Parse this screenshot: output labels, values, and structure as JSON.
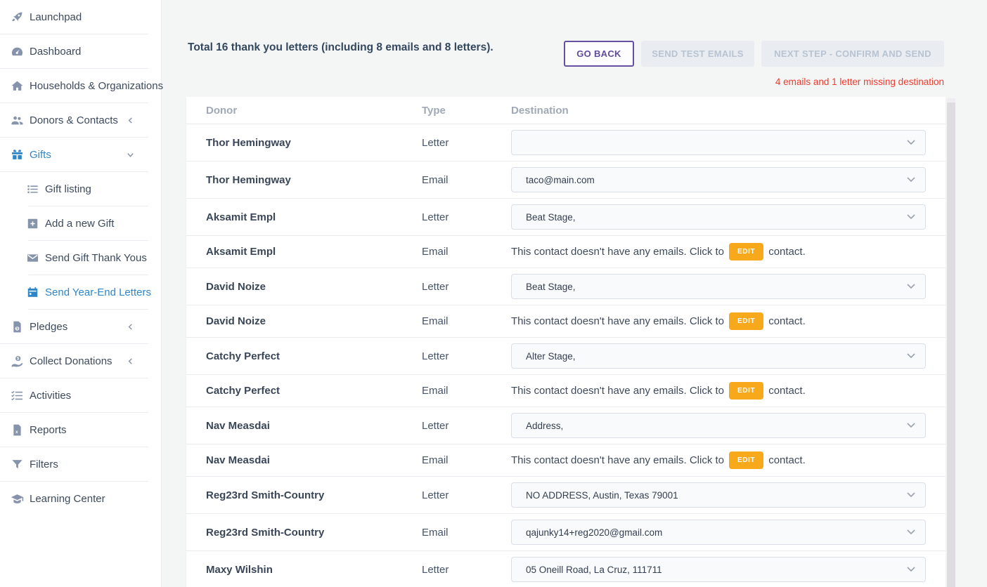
{
  "sidebar": {
    "items": [
      {
        "label": "Launchpad",
        "icon": "rocket-icon"
      },
      {
        "label": "Dashboard",
        "icon": "gauge-icon"
      },
      {
        "label": "Households & Organizations",
        "icon": "home-icon"
      },
      {
        "label": "Donors & Contacts",
        "icon": "users-icon",
        "chevron": "collapsed"
      },
      {
        "label": "Gifts",
        "icon": "gift-icon",
        "chevron": "expanded",
        "active": true
      },
      {
        "label": "Gift listing",
        "icon": "list-icon",
        "sub": true
      },
      {
        "label": "Add a new Gift",
        "icon": "plus-square-icon",
        "sub": true
      },
      {
        "label": "Send Gift Thank Yous",
        "icon": "envelope-icon",
        "sub": true
      },
      {
        "label": "Send Year-End Letters",
        "icon": "calendar-icon",
        "sub": true,
        "active": true
      },
      {
        "label": "Pledges",
        "icon": "invoice-dollar-icon",
        "chevron": "collapsed"
      },
      {
        "label": "Collect Donations",
        "icon": "hand-dollar-icon",
        "chevron": "collapsed"
      },
      {
        "label": "Activities",
        "icon": "checklist-icon"
      },
      {
        "label": "Reports",
        "icon": "file-report-icon"
      },
      {
        "label": "Filters",
        "icon": "funnel-icon"
      },
      {
        "label": "Learning Center",
        "icon": "graduation-cap-icon"
      }
    ]
  },
  "header": {
    "total_text": "Total 16 thank you letters (including 8 emails and 8 letters).",
    "buttons": {
      "go_back": "GO BACK",
      "send_test": "SEND TEST EMAILS",
      "next_step": "NEXT STEP - CONFIRM AND SEND"
    },
    "warning": "4 emails and 1 letter missing destination"
  },
  "table": {
    "columns": [
      "Donor",
      "Type",
      "Destination"
    ],
    "no_email_msg": {
      "before": "This contact doesn't have any emails. Click to",
      "edit_label": "EDIT",
      "after": "contact."
    },
    "rows": [
      {
        "donor": "Thor Hemingway",
        "type": "Letter",
        "destination": ""
      },
      {
        "donor": "Thor Hemingway",
        "type": "Email",
        "destination": "taco@main.com"
      },
      {
        "donor": "Aksamit Empl",
        "type": "Letter",
        "destination": "Beat Stage,"
      },
      {
        "donor": "Aksamit Empl",
        "type": "Email",
        "no_email": true
      },
      {
        "donor": "David Noize",
        "type": "Letter",
        "destination": "Beat Stage,"
      },
      {
        "donor": "David Noize",
        "type": "Email",
        "no_email": true
      },
      {
        "donor": "Catchy Perfect",
        "type": "Letter",
        "destination": "Alter Stage,"
      },
      {
        "donor": "Catchy Perfect",
        "type": "Email",
        "no_email": true
      },
      {
        "donor": "Nav Measdai",
        "type": "Letter",
        "destination": "Address,"
      },
      {
        "donor": "Nav Measdai",
        "type": "Email",
        "no_email": true
      },
      {
        "donor": "Reg23rd Smith-Country",
        "type": "Letter",
        "destination": "NO ADDRESS, Austin, Texas 79001"
      },
      {
        "donor": "Reg23rd Smith-Country",
        "type": "Email",
        "destination": "qajunky14+reg2020@gmail.com"
      },
      {
        "donor": "Maxy Wilshin",
        "type": "Letter",
        "destination": "05 Oneill Road, La Cruz, 111711"
      }
    ]
  },
  "colors": {
    "active_blue": "#2e86c8",
    "warning_red": "#ef3a2e",
    "edit_orange": "#f7a81b",
    "go_back_purple": "#5f4b9e",
    "icon_gray": "#8593ab"
  }
}
